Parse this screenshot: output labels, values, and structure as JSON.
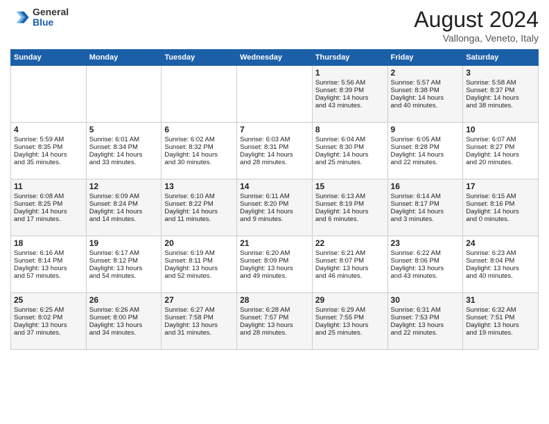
{
  "header": {
    "logo_general": "General",
    "logo_blue": "Blue",
    "month_year": "August 2024",
    "location": "Vallonga, Veneto, Italy"
  },
  "days_of_week": [
    "Sunday",
    "Monday",
    "Tuesday",
    "Wednesday",
    "Thursday",
    "Friday",
    "Saturday"
  ],
  "weeks": [
    [
      {
        "day": "",
        "content": ""
      },
      {
        "day": "",
        "content": ""
      },
      {
        "day": "",
        "content": ""
      },
      {
        "day": "",
        "content": ""
      },
      {
        "day": "1",
        "content": "Sunrise: 5:56 AM\nSunset: 8:39 PM\nDaylight: 14 hours\nand 43 minutes."
      },
      {
        "day": "2",
        "content": "Sunrise: 5:57 AM\nSunset: 8:38 PM\nDaylight: 14 hours\nand 40 minutes."
      },
      {
        "day": "3",
        "content": "Sunrise: 5:58 AM\nSunset: 8:37 PM\nDaylight: 14 hours\nand 38 minutes."
      }
    ],
    [
      {
        "day": "4",
        "content": "Sunrise: 5:59 AM\nSunset: 8:35 PM\nDaylight: 14 hours\nand 35 minutes."
      },
      {
        "day": "5",
        "content": "Sunrise: 6:01 AM\nSunset: 8:34 PM\nDaylight: 14 hours\nand 33 minutes."
      },
      {
        "day": "6",
        "content": "Sunrise: 6:02 AM\nSunset: 8:32 PM\nDaylight: 14 hours\nand 30 minutes."
      },
      {
        "day": "7",
        "content": "Sunrise: 6:03 AM\nSunset: 8:31 PM\nDaylight: 14 hours\nand 28 minutes."
      },
      {
        "day": "8",
        "content": "Sunrise: 6:04 AM\nSunset: 8:30 PM\nDaylight: 14 hours\nand 25 minutes."
      },
      {
        "day": "9",
        "content": "Sunrise: 6:05 AM\nSunset: 8:28 PM\nDaylight: 14 hours\nand 22 minutes."
      },
      {
        "day": "10",
        "content": "Sunrise: 6:07 AM\nSunset: 8:27 PM\nDaylight: 14 hours\nand 20 minutes."
      }
    ],
    [
      {
        "day": "11",
        "content": "Sunrise: 6:08 AM\nSunset: 8:25 PM\nDaylight: 14 hours\nand 17 minutes."
      },
      {
        "day": "12",
        "content": "Sunrise: 6:09 AM\nSunset: 8:24 PM\nDaylight: 14 hours\nand 14 minutes."
      },
      {
        "day": "13",
        "content": "Sunrise: 6:10 AM\nSunset: 8:22 PM\nDaylight: 14 hours\nand 11 minutes."
      },
      {
        "day": "14",
        "content": "Sunrise: 6:11 AM\nSunset: 8:20 PM\nDaylight: 14 hours\nand 9 minutes."
      },
      {
        "day": "15",
        "content": "Sunrise: 6:13 AM\nSunset: 8:19 PM\nDaylight: 14 hours\nand 6 minutes."
      },
      {
        "day": "16",
        "content": "Sunrise: 6:14 AM\nSunset: 8:17 PM\nDaylight: 14 hours\nand 3 minutes."
      },
      {
        "day": "17",
        "content": "Sunrise: 6:15 AM\nSunset: 8:16 PM\nDaylight: 14 hours\nand 0 minutes."
      }
    ],
    [
      {
        "day": "18",
        "content": "Sunrise: 6:16 AM\nSunset: 8:14 PM\nDaylight: 13 hours\nand 57 minutes."
      },
      {
        "day": "19",
        "content": "Sunrise: 6:17 AM\nSunset: 8:12 PM\nDaylight: 13 hours\nand 54 minutes."
      },
      {
        "day": "20",
        "content": "Sunrise: 6:19 AM\nSunset: 8:11 PM\nDaylight: 13 hours\nand 52 minutes."
      },
      {
        "day": "21",
        "content": "Sunrise: 6:20 AM\nSunset: 8:09 PM\nDaylight: 13 hours\nand 49 minutes."
      },
      {
        "day": "22",
        "content": "Sunrise: 6:21 AM\nSunset: 8:07 PM\nDaylight: 13 hours\nand 46 minutes."
      },
      {
        "day": "23",
        "content": "Sunrise: 6:22 AM\nSunset: 8:06 PM\nDaylight: 13 hours\nand 43 minutes."
      },
      {
        "day": "24",
        "content": "Sunrise: 6:23 AM\nSunset: 8:04 PM\nDaylight: 13 hours\nand 40 minutes."
      }
    ],
    [
      {
        "day": "25",
        "content": "Sunrise: 6:25 AM\nSunset: 8:02 PM\nDaylight: 13 hours\nand 37 minutes."
      },
      {
        "day": "26",
        "content": "Sunrise: 6:26 AM\nSunset: 8:00 PM\nDaylight: 13 hours\nand 34 minutes."
      },
      {
        "day": "27",
        "content": "Sunrise: 6:27 AM\nSunset: 7:58 PM\nDaylight: 13 hours\nand 31 minutes."
      },
      {
        "day": "28",
        "content": "Sunrise: 6:28 AM\nSunset: 7:57 PM\nDaylight: 13 hours\nand 28 minutes."
      },
      {
        "day": "29",
        "content": "Sunrise: 6:29 AM\nSunset: 7:55 PM\nDaylight: 13 hours\nand 25 minutes."
      },
      {
        "day": "30",
        "content": "Sunrise: 6:31 AM\nSunset: 7:53 PM\nDaylight: 13 hours\nand 22 minutes."
      },
      {
        "day": "31",
        "content": "Sunrise: 6:32 AM\nSunset: 7:51 PM\nDaylight: 13 hours\nand 19 minutes."
      }
    ]
  ]
}
